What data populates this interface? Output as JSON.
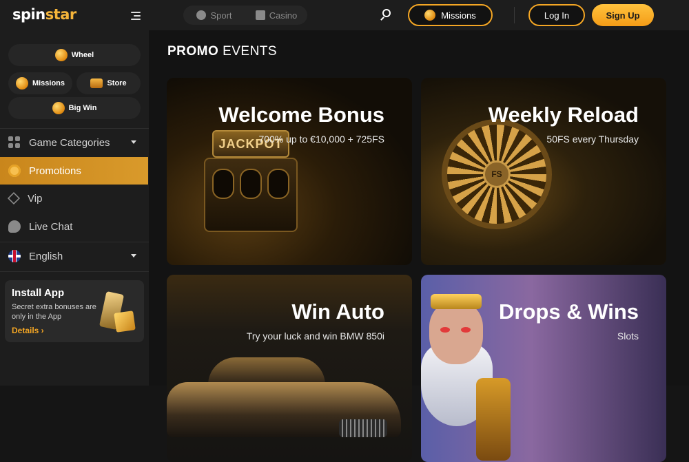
{
  "header": {
    "logo_spin": "spin",
    "logo_star": "star",
    "toggle": [
      {
        "label": "Sport",
        "icon": "soccer-ball-icon"
      },
      {
        "label": "Casino",
        "icon": "slot-machine-icon"
      }
    ],
    "missions_label": "Missions",
    "login_label": "Log In",
    "signup_label": "Sign Up"
  },
  "sidebar": {
    "quick": [
      {
        "label": "Wheel"
      },
      {
        "label": "Missions"
      },
      {
        "label": "Store"
      },
      {
        "label": "Big Win"
      }
    ],
    "nav": [
      {
        "label": "Game Categories",
        "icon": "grid-icon",
        "has_dropdown": true
      },
      {
        "label": "Promotions",
        "icon": "gear-icon",
        "active": true
      },
      {
        "label": "Vip",
        "icon": "diamond-icon"
      },
      {
        "label": "Live Chat",
        "icon": "chat-icon"
      },
      {
        "label": "English",
        "icon": "uk-flag-icon",
        "has_dropdown": true
      }
    ],
    "install": {
      "title": "Install App",
      "text": "Secret extra bonuses are only in the App",
      "link": "Details ›"
    }
  },
  "main": {
    "heading_bold": "PROMO",
    "heading_light": "EVENTS",
    "cards": [
      {
        "title": "Welcome Bonus",
        "subtitle": "700% up to €10,000 + 725FS",
        "art_text": "JACKPOT"
      },
      {
        "title": "Weekly Reload",
        "subtitle": "50FS every Thursday",
        "art_text": "FS"
      },
      {
        "title": "Win Auto",
        "subtitle": "Try your luck and win BMW 850i"
      },
      {
        "title": "Drops & Wins",
        "subtitle": "Slots"
      }
    ]
  },
  "colors": {
    "accent": "#f4a624",
    "active_nav": "#d99a2b",
    "background": "#131313",
    "sidebar": "#1d1d1d"
  }
}
